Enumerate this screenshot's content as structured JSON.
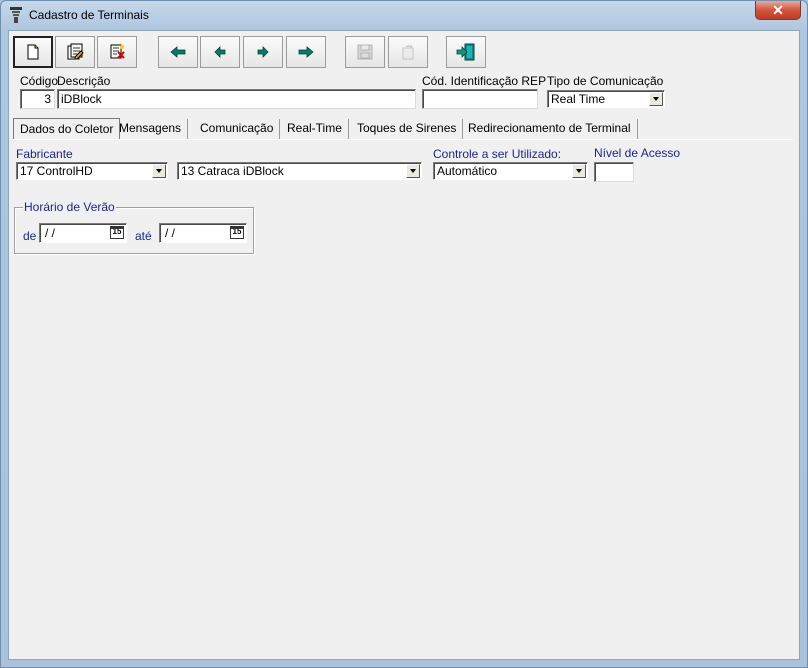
{
  "window": {
    "title": "Cadastro de Terminais",
    "close_glyph": "✕"
  },
  "toolbar": {
    "buttons": [
      {
        "icon": "new-document-icon",
        "enabled": true
      },
      {
        "icon": "edit-icon",
        "enabled": true
      },
      {
        "icon": "delete-icon",
        "enabled": true
      },
      {
        "icon": "first-record-icon",
        "enabled": true
      },
      {
        "icon": "previous-record-icon",
        "enabled": true
      },
      {
        "icon": "next-record-icon",
        "enabled": true
      },
      {
        "icon": "last-record-icon",
        "enabled": true
      },
      {
        "icon": "save-icon",
        "enabled": false
      },
      {
        "icon": "undo-icon",
        "enabled": false
      },
      {
        "icon": "exit-icon",
        "enabled": true
      }
    ]
  },
  "header": {
    "codigo_label": "Código",
    "codigo_value": "3",
    "descricao_label": "Descrição",
    "descricao_value": "iDBlock",
    "rep_label": "Cód. Identificação REP",
    "rep_value": "",
    "comunicacao_label": "Tipo de Comunicação",
    "comunicacao_value": "Real Time"
  },
  "tabs": [
    {
      "label": "Dados do Coletor",
      "active": true
    },
    {
      "label": "Mensagens",
      "active": false
    },
    {
      "label": "Comunicação",
      "active": false
    },
    {
      "label": "Real-Time",
      "active": false
    },
    {
      "label": "Toques de Sirenes",
      "active": false
    },
    {
      "label": "Redirecionamento de Terminal",
      "active": false
    }
  ],
  "coletor": {
    "fabricante_label": "Fabricante",
    "fabricante_value": "17 ControlHD",
    "modelo_value": "13 Catraca iDBlock",
    "controle_label": "Controle a ser Utilizado:",
    "controle_value": "Automático",
    "nivel_label": "Nível de Acesso",
    "nivel_value": ""
  },
  "horario_verao": {
    "title": "Horário de Verão",
    "de_label": "de",
    "de_value": " /  /",
    "ate_label": "até",
    "ate_value": " /  /",
    "calendar_glyph": "15"
  },
  "colors": {
    "label_blue": "#1f1f8f",
    "client_bg": "#f0f0f0",
    "close_red": "#c23a22"
  }
}
